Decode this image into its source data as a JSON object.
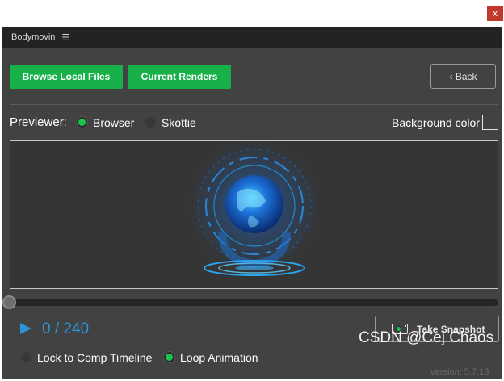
{
  "window": {
    "close_label": "x"
  },
  "panel": {
    "title": "Bodymovin",
    "menu_icon": "hamburger-menu-icon"
  },
  "toolbar": {
    "browse_local_files": "Browse Local Files",
    "current_renders": "Current Renders",
    "back": "‹ Back"
  },
  "previewer": {
    "label": "Previewer:",
    "options": [
      {
        "label": "Browser",
        "selected": true
      },
      {
        "label": "Skottie",
        "selected": false
      }
    ],
    "background_color_label": "Background color"
  },
  "playback": {
    "frame_display": "0 / 240",
    "current_frame": 0,
    "total_frames": 240,
    "take_snapshot": "Take Snapshot",
    "lock_to_comp_timeline": {
      "label": "Lock to Comp Timeline",
      "checked": false
    },
    "loop_animation": {
      "label": "Loop Animation",
      "checked": true
    },
    "version": "Version: 5.7.13"
  },
  "watermark": "CSDN @Cej Chaos",
  "colors": {
    "accent_green": "#17b14a",
    "accent_blue": "#2c93d6",
    "panel_bg": "#424242",
    "header_bg": "#232323",
    "close_red": "#c0392b"
  }
}
